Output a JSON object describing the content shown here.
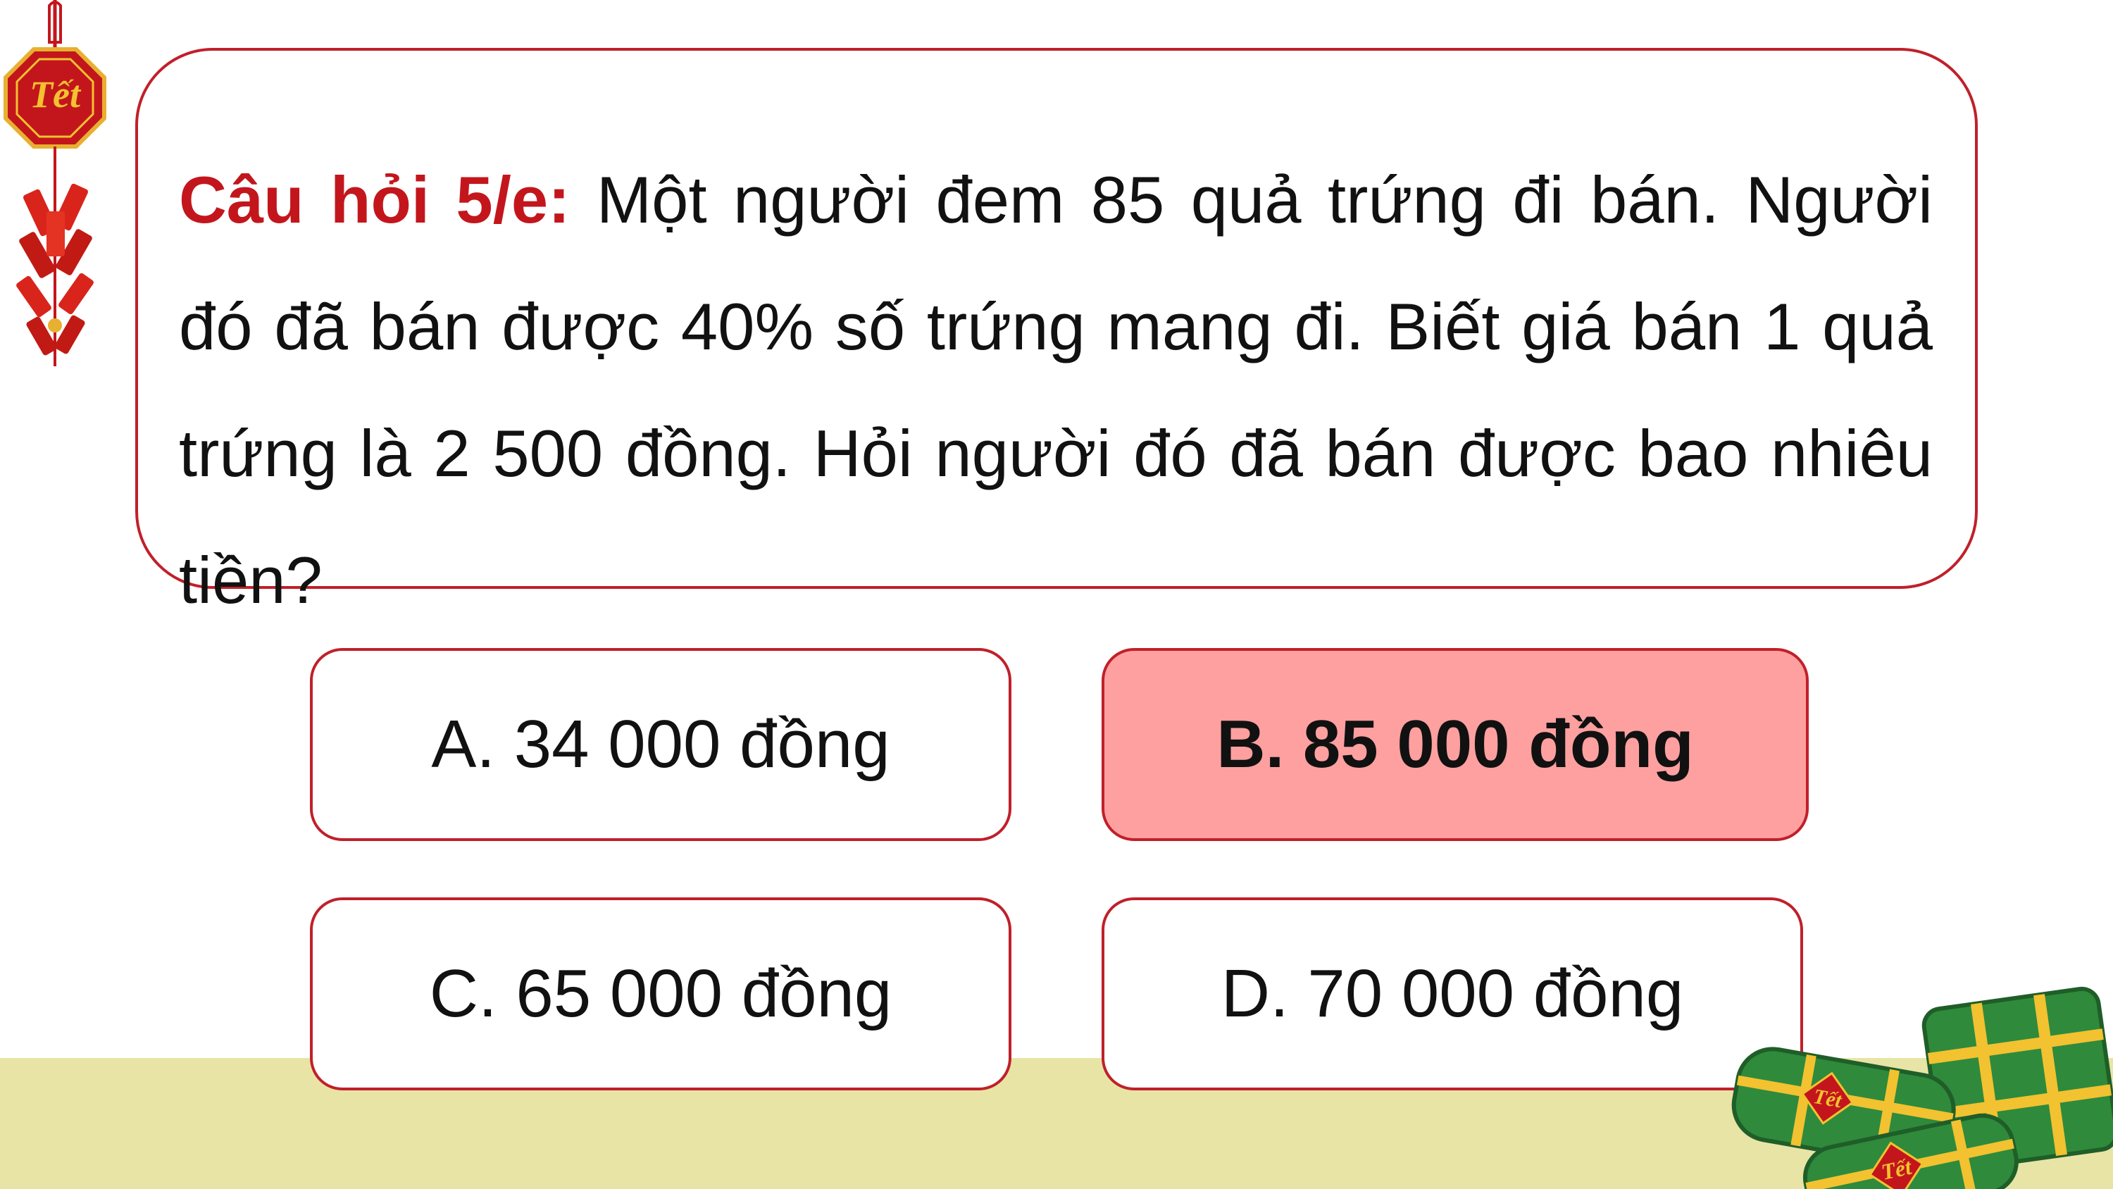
{
  "question": {
    "prefix": "Câu hỏi 5/e:",
    "text": "Một người đem 85 quả trứng đi bán. Người đó đã bán được 40% số trứng mang đi. Biết giá bán 1 quả trứng là 2 500 đồng. Hỏi người đó đã bán được bao nhiêu tiền?"
  },
  "answers": [
    {
      "label": "A. 34 000 đồng",
      "selected": false
    },
    {
      "label": "B. 85 000 đồng",
      "selected": true
    },
    {
      "label": "C. 65 000 đồng",
      "selected": false
    },
    {
      "label": "D. 70 000 đồng",
      "selected": false
    }
  ],
  "decorations": {
    "ornament_text": "Tết",
    "banh_text": "Tết",
    "icons": [
      "tet-ornament-icon",
      "firecracker-icon",
      "banh-chung-icon"
    ]
  },
  "colors": {
    "accent_red": "#c3161c",
    "border_red": "#c0202a",
    "selected_fill": "#fea0a0",
    "floor": "#e8e4a6",
    "leaf_green": "#2f8a3c",
    "string_yellow": "#f2c230"
  }
}
